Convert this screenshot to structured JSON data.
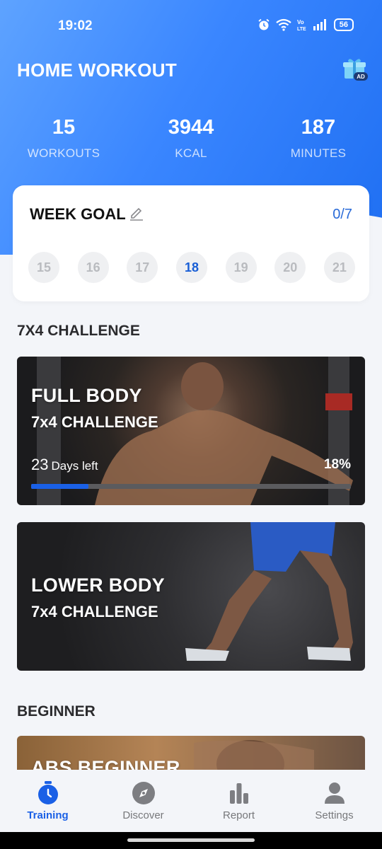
{
  "status_bar": {
    "time": "19:02",
    "battery": "56",
    "icons": [
      "alarm-icon",
      "wifi-icon",
      "volte-icon",
      "signal-icon",
      "battery-icon"
    ]
  },
  "header": {
    "title": "HOME WORKOUT",
    "ad_badge": "AD"
  },
  "stats": [
    {
      "value": "15",
      "label": "WORKOUTS"
    },
    {
      "value": "3944",
      "label": "KCAL"
    },
    {
      "value": "187",
      "label": "MINUTES"
    }
  ],
  "week_goal": {
    "title": "WEEK GOAL",
    "progress": "0/7",
    "days": [
      "15",
      "16",
      "17",
      "18",
      "19",
      "20",
      "21"
    ],
    "today": "18"
  },
  "sections": {
    "challenge_title": "7X4 CHALLENGE",
    "beginner_title": "BEGINNER"
  },
  "cards": {
    "full_body": {
      "title": "FULL BODY",
      "subtitle": "7x4 CHALLENGE",
      "days_left_number": "23",
      "days_left_text": "Days left",
      "percent": "18%",
      "progress_fraction": 0.18
    },
    "lower_body": {
      "title": "LOWER BODY",
      "subtitle": "7x4 CHALLENGE"
    },
    "abs_beginner": {
      "title": "ABS BEGINNER"
    }
  },
  "bottom_nav": [
    {
      "label": "Training",
      "icon": "stopwatch-icon",
      "active": true
    },
    {
      "label": "Discover",
      "icon": "compass-icon",
      "active": false
    },
    {
      "label": "Report",
      "icon": "bar-chart-icon",
      "active": false
    },
    {
      "label": "Settings",
      "icon": "person-icon",
      "active": false
    }
  ],
  "colors": {
    "accent": "#1a60e6",
    "hero_gradient_start": "#5ea3ff",
    "hero_gradient_end": "#1f6ff2"
  }
}
